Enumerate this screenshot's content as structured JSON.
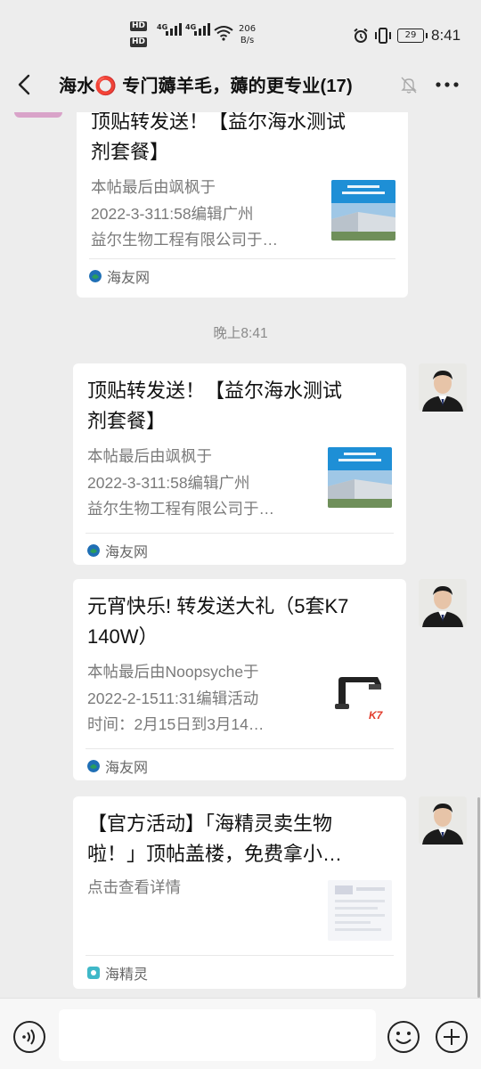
{
  "status_bar": {
    "speed_value": "206",
    "speed_unit": "B/s",
    "battery": "29",
    "time": "8:41",
    "icons": [
      "hd-icon",
      "signal-icon",
      "wifi-icon",
      "alarm-icon",
      "vibrate-icon",
      "battery-icon"
    ]
  },
  "nav": {
    "title": "海水⭕ 专门薅羊毛，薅的更专业(17)",
    "icons": [
      "back-icon",
      "mute-icon",
      "more-icon"
    ]
  },
  "messages": [
    {
      "title_line1": "顶贴转发送！【益尔海水测试",
      "title_line2": "剂套餐】",
      "desc_line1": "本帖最后由飒枫于",
      "desc_line2": "2022-3-311:58编辑广州",
      "desc_line3": "益尔生物工程有限公司于…",
      "source": "海友网"
    },
    {
      "time_separator": "晚上8:41"
    },
    {
      "title_line1": "顶贴转发送！【益尔海水测试",
      "title_line2": "剂套餐】",
      "desc_line1": "本帖最后由飒枫于",
      "desc_line2": "2022-3-311:58编辑广州",
      "desc_line3": "益尔生物工程有限公司于…",
      "source": "海友网"
    },
    {
      "title_line1": "元宵快乐! 转发送大礼（5套K7",
      "title_line2": "140W）",
      "desc_line1": "本帖最后由Noopsyche于",
      "desc_line2": "2022-2-1511:31编辑活动",
      "desc_line3": "时间：2月15日到3月14…",
      "source": "海友网",
      "thumb_logo": "K7"
    },
    {
      "title_line1": "【官方活动】「海精灵卖生物",
      "title_line2": "啦！」顶帖盖楼，免费拿小…",
      "desc_line1": "点击查看详情",
      "source": "海精灵"
    }
  ],
  "colors": {
    "background": "#ededed",
    "card": "#ffffff",
    "source_green": "#2a9d5c",
    "source_blue": "#1f6fb5",
    "haijingling_teal": "#3fb8c8"
  }
}
